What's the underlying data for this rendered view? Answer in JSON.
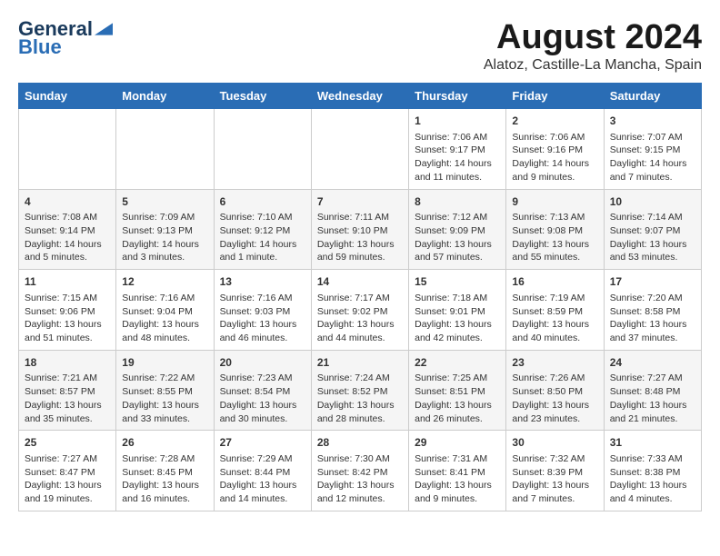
{
  "logo": {
    "line1": "General",
    "line2": "Blue"
  },
  "title": "August 2024",
  "subtitle": "Alatoz, Castille-La Mancha, Spain",
  "days_of_week": [
    "Sunday",
    "Monday",
    "Tuesday",
    "Wednesday",
    "Thursday",
    "Friday",
    "Saturday"
  ],
  "weeks": [
    [
      {
        "day": "",
        "content": ""
      },
      {
        "day": "",
        "content": ""
      },
      {
        "day": "",
        "content": ""
      },
      {
        "day": "",
        "content": ""
      },
      {
        "day": "1",
        "content": "Sunrise: 7:06 AM\nSunset: 9:17 PM\nDaylight: 14 hours\nand 11 minutes."
      },
      {
        "day": "2",
        "content": "Sunrise: 7:06 AM\nSunset: 9:16 PM\nDaylight: 14 hours\nand 9 minutes."
      },
      {
        "day": "3",
        "content": "Sunrise: 7:07 AM\nSunset: 9:15 PM\nDaylight: 14 hours\nand 7 minutes."
      }
    ],
    [
      {
        "day": "4",
        "content": "Sunrise: 7:08 AM\nSunset: 9:14 PM\nDaylight: 14 hours\nand 5 minutes."
      },
      {
        "day": "5",
        "content": "Sunrise: 7:09 AM\nSunset: 9:13 PM\nDaylight: 14 hours\nand 3 minutes."
      },
      {
        "day": "6",
        "content": "Sunrise: 7:10 AM\nSunset: 9:12 PM\nDaylight: 14 hours\nand 1 minute."
      },
      {
        "day": "7",
        "content": "Sunrise: 7:11 AM\nSunset: 9:10 PM\nDaylight: 13 hours\nand 59 minutes."
      },
      {
        "day": "8",
        "content": "Sunrise: 7:12 AM\nSunset: 9:09 PM\nDaylight: 13 hours\nand 57 minutes."
      },
      {
        "day": "9",
        "content": "Sunrise: 7:13 AM\nSunset: 9:08 PM\nDaylight: 13 hours\nand 55 minutes."
      },
      {
        "day": "10",
        "content": "Sunrise: 7:14 AM\nSunset: 9:07 PM\nDaylight: 13 hours\nand 53 minutes."
      }
    ],
    [
      {
        "day": "11",
        "content": "Sunrise: 7:15 AM\nSunset: 9:06 PM\nDaylight: 13 hours\nand 51 minutes."
      },
      {
        "day": "12",
        "content": "Sunrise: 7:16 AM\nSunset: 9:04 PM\nDaylight: 13 hours\nand 48 minutes."
      },
      {
        "day": "13",
        "content": "Sunrise: 7:16 AM\nSunset: 9:03 PM\nDaylight: 13 hours\nand 46 minutes."
      },
      {
        "day": "14",
        "content": "Sunrise: 7:17 AM\nSunset: 9:02 PM\nDaylight: 13 hours\nand 44 minutes."
      },
      {
        "day": "15",
        "content": "Sunrise: 7:18 AM\nSunset: 9:01 PM\nDaylight: 13 hours\nand 42 minutes."
      },
      {
        "day": "16",
        "content": "Sunrise: 7:19 AM\nSunset: 8:59 PM\nDaylight: 13 hours\nand 40 minutes."
      },
      {
        "day": "17",
        "content": "Sunrise: 7:20 AM\nSunset: 8:58 PM\nDaylight: 13 hours\nand 37 minutes."
      }
    ],
    [
      {
        "day": "18",
        "content": "Sunrise: 7:21 AM\nSunset: 8:57 PM\nDaylight: 13 hours\nand 35 minutes."
      },
      {
        "day": "19",
        "content": "Sunrise: 7:22 AM\nSunset: 8:55 PM\nDaylight: 13 hours\nand 33 minutes."
      },
      {
        "day": "20",
        "content": "Sunrise: 7:23 AM\nSunset: 8:54 PM\nDaylight: 13 hours\nand 30 minutes."
      },
      {
        "day": "21",
        "content": "Sunrise: 7:24 AM\nSunset: 8:52 PM\nDaylight: 13 hours\nand 28 minutes."
      },
      {
        "day": "22",
        "content": "Sunrise: 7:25 AM\nSunset: 8:51 PM\nDaylight: 13 hours\nand 26 minutes."
      },
      {
        "day": "23",
        "content": "Sunrise: 7:26 AM\nSunset: 8:50 PM\nDaylight: 13 hours\nand 23 minutes."
      },
      {
        "day": "24",
        "content": "Sunrise: 7:27 AM\nSunset: 8:48 PM\nDaylight: 13 hours\nand 21 minutes."
      }
    ],
    [
      {
        "day": "25",
        "content": "Sunrise: 7:27 AM\nSunset: 8:47 PM\nDaylight: 13 hours\nand 19 minutes."
      },
      {
        "day": "26",
        "content": "Sunrise: 7:28 AM\nSunset: 8:45 PM\nDaylight: 13 hours\nand 16 minutes."
      },
      {
        "day": "27",
        "content": "Sunrise: 7:29 AM\nSunset: 8:44 PM\nDaylight: 13 hours\nand 14 minutes."
      },
      {
        "day": "28",
        "content": "Sunrise: 7:30 AM\nSunset: 8:42 PM\nDaylight: 13 hours\nand 12 minutes."
      },
      {
        "day": "29",
        "content": "Sunrise: 7:31 AM\nSunset: 8:41 PM\nDaylight: 13 hours\nand 9 minutes."
      },
      {
        "day": "30",
        "content": "Sunrise: 7:32 AM\nSunset: 8:39 PM\nDaylight: 13 hours\nand 7 minutes."
      },
      {
        "day": "31",
        "content": "Sunrise: 7:33 AM\nSunset: 8:38 PM\nDaylight: 13 hours\nand 4 minutes."
      }
    ]
  ]
}
